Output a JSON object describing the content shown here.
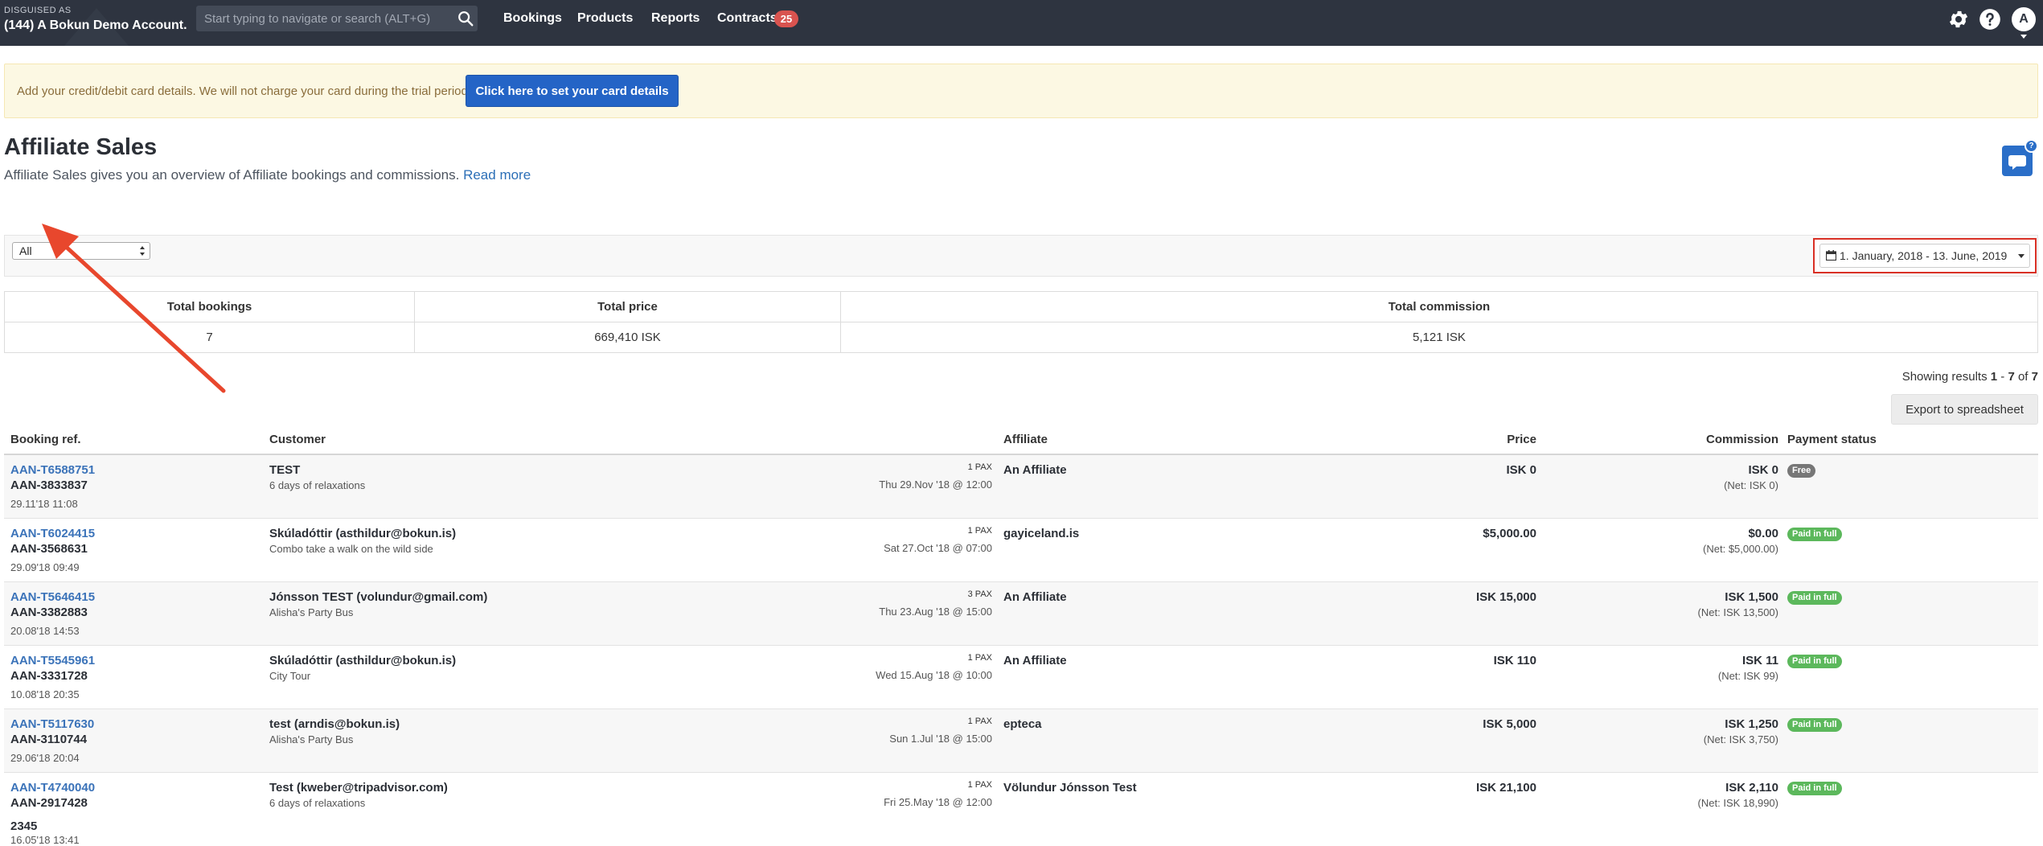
{
  "topbar": {
    "disguised_label": "DISGUISED AS",
    "account_name": "(144) A Bokun Demo Account.",
    "search_placeholder": "Start typing to navigate or search (ALT+G)",
    "nav": [
      {
        "label": "Bookings"
      },
      {
        "label": "Products"
      },
      {
        "label": "Reports"
      },
      {
        "label": "Contracts"
      }
    ],
    "contracts_badge": "25",
    "avatar_initial": "A"
  },
  "banner": {
    "text": "Add your credit/debit card details. We will not charge your card during the trial period.",
    "button_label": "Click here to set your card details"
  },
  "header": {
    "title": "Affiliate Sales",
    "subtitle": "Affiliate Sales gives you an overview of Affiliate bookings and commissions.",
    "read_more": "Read more",
    "chat_badge": "?"
  },
  "filters": {
    "affiliate_select": "All",
    "date_range": "1. January, 2018 - 13. June, 2019"
  },
  "totals": {
    "headers": [
      "Total bookings",
      "Total price",
      "Total commission"
    ],
    "values": [
      "7",
      "669,410 ISK",
      "5,121 ISK"
    ]
  },
  "results": {
    "prefix": "Showing results",
    "from": "1",
    "sep": "-",
    "to": "7",
    "of": "of",
    "total": "7"
  },
  "export_label": "Export to spreadsheet",
  "table": {
    "headers": {
      "ref": "Booking ref.",
      "customer": "Customer",
      "affiliate": "Affiliate",
      "price": "Price",
      "commission": "Commission",
      "status": "Payment status"
    },
    "rows": [
      {
        "ref": "AAN-T6588751",
        "ref2": "AAN-3833837",
        "extra": "",
        "date": "29.11'18 11:08",
        "customer": "TEST",
        "product": "6 days of relaxations",
        "pax": "1 PAX",
        "when": "Thu 29.Nov '18 @ 12:00",
        "affiliate": "An Affiliate",
        "price": "ISK 0",
        "commission": "ISK 0",
        "net": "(Net: ISK 0)",
        "status": "Free"
      },
      {
        "ref": "AAN-T6024415",
        "ref2": "AAN-3568631",
        "extra": "",
        "date": "29.09'18 09:49",
        "customer": "Skúladóttir (asthildur@bokun.is)",
        "product": "Combo take a walk on the wild side",
        "pax": "1 PAX",
        "when": "Sat 27.Oct '18 @ 07:00",
        "affiliate": "gayiceland.is",
        "price": "$5,000.00",
        "commission": "$0.00",
        "net": "(Net: $5,000.00)",
        "status": "Paid in full"
      },
      {
        "ref": "AAN-T5646415",
        "ref2": "AAN-3382883",
        "extra": "",
        "date": "20.08'18 14:53",
        "customer": "Jónsson TEST (volundur@gmail.com)",
        "product": "Alisha's Party Bus",
        "pax": "3 PAX",
        "when": "Thu 23.Aug '18 @ 15:00",
        "affiliate": "An Affiliate",
        "price": "ISK 15,000",
        "commission": "ISK 1,500",
        "net": "(Net: ISK 13,500)",
        "status": "Paid in full"
      },
      {
        "ref": "AAN-T5545961",
        "ref2": "AAN-3331728",
        "extra": "",
        "date": "10.08'18 20:35",
        "customer": "Skúladóttir (asthildur@bokun.is)",
        "product": "City Tour",
        "pax": "1 PAX",
        "when": "Wed 15.Aug '18 @ 10:00",
        "affiliate": "An Affiliate",
        "price": "ISK 110",
        "commission": "ISK 11",
        "net": "(Net: ISK 99)",
        "status": "Paid in full"
      },
      {
        "ref": "AAN-T5117630",
        "ref2": "AAN-3110744",
        "extra": "",
        "date": "29.06'18 20:04",
        "customer": "test (arndis@bokun.is)",
        "product": "Alisha's Party Bus",
        "pax": "1 PAX",
        "when": "Sun 1.Jul '18 @ 15:00",
        "affiliate": "epteca",
        "price": "ISK 5,000",
        "commission": "ISK 1,250",
        "net": "(Net: ISK 3,750)",
        "status": "Paid in full"
      },
      {
        "ref": "AAN-T4740040",
        "ref2": "AAN-2917428",
        "extra": "2345",
        "date": "16.05'18 13:41",
        "customer": "Test (kweber@tripadvisor.com)",
        "product": "6 days of relaxations",
        "pax": "1 PAX",
        "when": "Fri 25.May '18 @ 12:00",
        "affiliate": "Völundur Jónsson Test",
        "price": "ISK 21,100",
        "commission": "ISK 2,110",
        "net": "(Net: ISK 18,990)",
        "status": "Paid in full"
      }
    ]
  },
  "colors": {
    "topbar": "#2e3440",
    "accent_blue": "#2464c6",
    "link_blue": "#3b73b9",
    "paid_green": "#5cb85c",
    "free_grey": "#777777",
    "highlight_red": "#d93025"
  }
}
